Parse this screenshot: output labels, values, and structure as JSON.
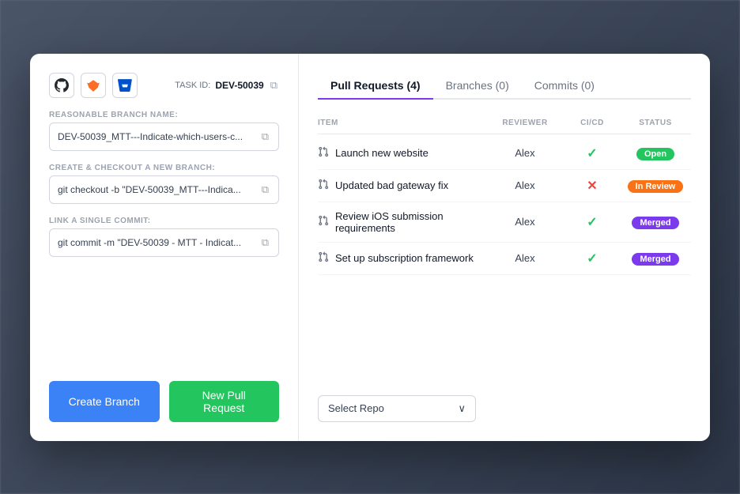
{
  "modal": {
    "left": {
      "providers": [
        {
          "name": "github",
          "symbol": "🐙"
        },
        {
          "name": "gitlab",
          "symbol": "🦊"
        },
        {
          "name": "bitbucket",
          "symbol": "🪣"
        }
      ],
      "task_id_label": "TASK ID:",
      "task_id_value": "DEV-50039",
      "fields": [
        {
          "label": "REASONABLE BRANCH NAME:",
          "value": "DEV-50039_MTT---Indicate-which-users-c..."
        },
        {
          "label": "CREATE & CHECKOUT A NEW BRANCH:",
          "value": "git checkout -b \"DEV-50039_MTT---Indica..."
        },
        {
          "label": "LINK A SINGLE COMMIT:",
          "value": "git commit -m \"DEV-50039 - MTT - Indicat..."
        }
      ],
      "btn_create_branch": "Create Branch",
      "btn_new_pr": "New Pull Request"
    },
    "right": {
      "tabs": [
        {
          "label": "Pull Requests",
          "count": 4,
          "active": true
        },
        {
          "label": "Branches",
          "count": 0,
          "active": false
        },
        {
          "label": "Commits",
          "count": 0,
          "active": false
        }
      ],
      "table": {
        "headers": [
          "ITEM",
          "REVIEWER",
          "CI/CD",
          "STATUS"
        ],
        "rows": [
          {
            "item": "Launch new website",
            "reviewer": "Alex",
            "cicd": "check",
            "status": "Open",
            "status_type": "open"
          },
          {
            "item": "Updated bad gateway fix",
            "reviewer": "Alex",
            "cicd": "cross",
            "status": "In Review",
            "status_type": "in-review"
          },
          {
            "item": "Review iOS submission requirements",
            "reviewer": "Alex",
            "cicd": "check",
            "status": "Merged",
            "status_type": "merged"
          },
          {
            "item": "Set up subscription framework",
            "reviewer": "Alex",
            "cicd": "check",
            "status": "Merged",
            "status_type": "merged"
          }
        ]
      },
      "select_repo_placeholder": "Select Repo"
    }
  }
}
